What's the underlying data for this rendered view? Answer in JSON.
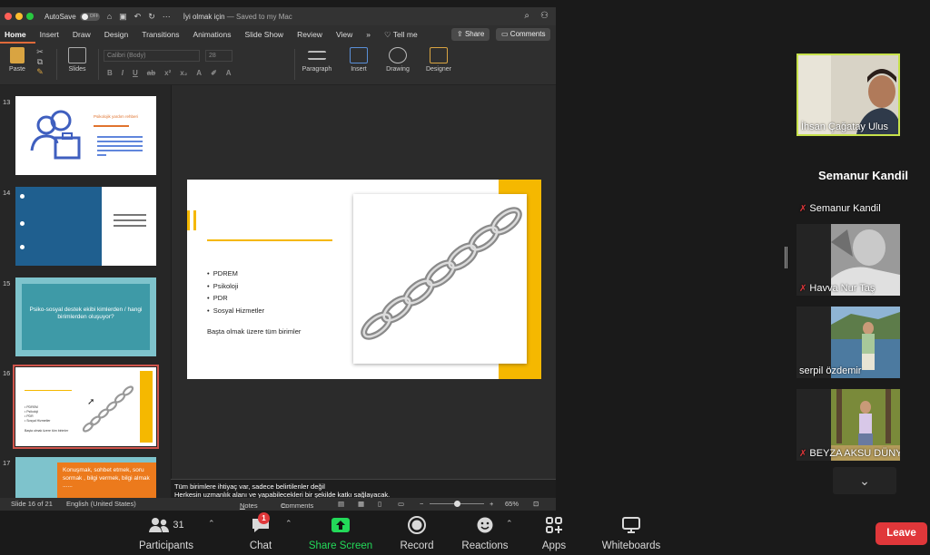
{
  "ppt": {
    "window": {
      "autosave_label": "AutoSave",
      "autosave_state": "OFF",
      "doc_title": "İyi olmak için",
      "saved_status": "— Saved to my Mac",
      "tell_me": "Tell me",
      "share": "Share",
      "comments": "Comments"
    },
    "ribbon_tabs": [
      "Home",
      "Insert",
      "Draw",
      "Design",
      "Transitions",
      "Animations",
      "Slide Show",
      "Review",
      "View"
    ],
    "ribbon": {
      "paste": "Paste",
      "slides": "Slides",
      "font_name": "Calibri (Body)",
      "font_size": "28",
      "paragraph": "Paragraph",
      "insert": "Insert",
      "drawing": "Drawing",
      "designer": "Designer"
    },
    "thumbnails": [
      {
        "num": "13",
        "title": "Psikolojik yardım rehberi"
      },
      {
        "num": "14",
        "title": ""
      },
      {
        "num": "15",
        "title": "Psiko-sosyal destek ekibi kimlerden / hangi birimlerden oluşuyor?"
      },
      {
        "num": "16",
        "title": ""
      },
      {
        "num": "17",
        "title": "Konuşmak, sohbet etmek, soru sormak , bilgi vermek, bilgi almak ......"
      }
    ],
    "slide": {
      "bullets": [
        "PDREM",
        "Psikoloji",
        "PDR",
        "Sosyal Hizmetler"
      ],
      "footer_text": "Başta olmak üzere tüm birimler",
      "accent_color": "#f5b800"
    },
    "notes": {
      "line1": "Tüm birimlere ihtiyaç var, sadece belirtilenler değil",
      "line2": "Herkesin uzmanlık alanı ve yapabilecekleri bir şekilde katkı sağlayacak."
    },
    "status": {
      "slide_pos": "Slide 16 of 21",
      "language": "English (United States)",
      "notes_btn": "Notes",
      "comments_btn": "Comments",
      "zoom": "65%",
      "zoom_fraction": 0.5
    }
  },
  "gallery": {
    "active_speaker": "İhsan Çağatay Ulus",
    "large_name": "Semanur Kandil",
    "participants": [
      {
        "name": "Semanur Kandil",
        "muted": true
      },
      {
        "name": "Havva Nur Taş",
        "muted": true
      },
      {
        "name": "serpil özdemir",
        "muted": false
      },
      {
        "name": "BEYZA AKSU DÜNYA",
        "muted": true
      }
    ],
    "scroll_down": "⌄"
  },
  "zoom_toolbar": {
    "participants_count": "31",
    "participants": "Participants",
    "chat": "Chat",
    "chat_badge": "1",
    "share_screen": "Share Screen",
    "record": "Record",
    "reactions": "Reactions",
    "apps": "Apps",
    "whiteboards": "Whiteboards",
    "leave": "Leave",
    "share_color": "#23d959",
    "leave_color": "#e0373a"
  }
}
